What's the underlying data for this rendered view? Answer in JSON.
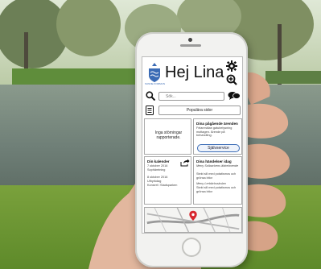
{
  "app": {
    "logo_text": "SUNNE KOMMUN",
    "greeting": "Hej Lina"
  },
  "icons": {
    "settings": "gear-icon",
    "zoom": "zoom-in-icon",
    "search": "search-icon",
    "chat": "chat-bubbles-icon",
    "popular": "document-list-icon",
    "share": "share-icon",
    "map_pin": "map-pin-icon"
  },
  "search": {
    "placeholder": "Sök..."
  },
  "popular": {
    "label": "Populära sidor"
  },
  "tiles": {
    "disruptions": {
      "message": "Inga störningar rapporterade."
    },
    "cases": {
      "title": "Dina pågående ärenden",
      "text": "Felanmälan gatubelysning mottagen. Ärende på behandling.",
      "button": "Självservice"
    },
    "calendar": {
      "title": "Din kalender",
      "line1": "7 oktober 2016",
      "line2": "Sophämtning",
      "line3": "8 oktober 2016",
      "line4": "Uthyrkdag",
      "line5": "Konsert i Stadsparken"
    },
    "events": {
      "title": "Dina händelser idag",
      "item1_title": "Meny Solbackens äldreboende",
      "item1_text": "Stekt sill med potatismos och grönsa bitor",
      "item2_title": "Meny Lerbäcksskolan",
      "item2_text": "Stekt sill med potatismos och grönsa bitor"
    }
  },
  "colors": {
    "accent": "#3a6bb5",
    "map_pin": "#d8262e"
  }
}
